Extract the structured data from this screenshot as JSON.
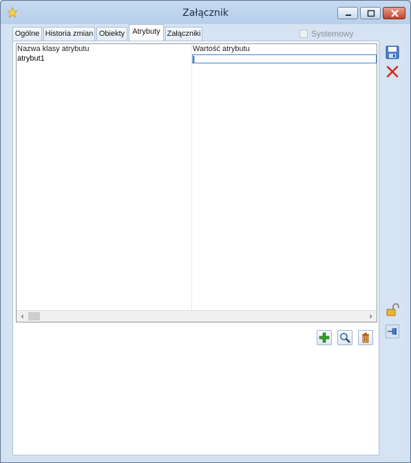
{
  "window": {
    "title": "Załącznik",
    "icon": "star-icon"
  },
  "tabs": [
    {
      "label": "Ogólne",
      "active": false
    },
    {
      "label": "Historia zmian",
      "active": false
    },
    {
      "label": "Obiekty",
      "active": false
    },
    {
      "label": "Atrybuty",
      "active": true
    },
    {
      "label": "Załączniki",
      "active": false
    }
  ],
  "systemowy": {
    "label": "Systemowy",
    "checked": false,
    "enabled": false
  },
  "grid": {
    "columns": [
      "Nazwa klasy atrybutu",
      "Wartość atrybutu"
    ],
    "rows": [
      {
        "name": "atrybut1",
        "value": ""
      }
    ]
  },
  "toolbar": {
    "add_icon": "plus-icon",
    "view_icon": "magnifier-icon",
    "delete_icon": "trash-icon"
  },
  "sidebar": {
    "save_icon": "floppy-disk-icon",
    "cancel_icon": "red-x-icon",
    "lock_icon": "padlock-icon",
    "pin_icon": "pin-icon"
  }
}
